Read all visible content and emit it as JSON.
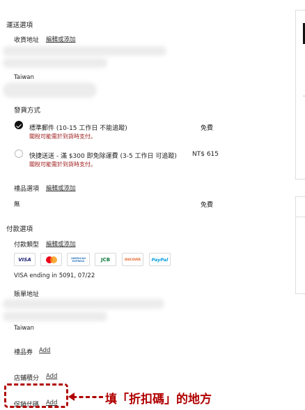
{
  "shipping": {
    "section_title": "運送選項",
    "address_label": "收貨地址",
    "address_edit": "編輯或添加",
    "address_country": "Taiwan",
    "method_title": "發貨方式",
    "options": [
      {
        "title": "標準郵件 (10-15 工作日 不能追蹤)",
        "note": "關稅可能需於到貨時支付。",
        "price": "免費",
        "selected": true
      },
      {
        "title": "快捷送送 - 滿 $300 即免除運費 (3-5 工作日 可追蹤)",
        "note": "關稅可能需於到貨時支付。",
        "price": "NT$ 615",
        "selected": false
      }
    ],
    "gift_label": "禮品選項",
    "gift_edit": "編輯或添加",
    "gift_value": "無",
    "gift_price": "免費"
  },
  "payment": {
    "section_title": "付款選項",
    "type_label": "付款類型",
    "type_edit": "編輯或添加",
    "cards": [
      {
        "icon": "visa-card-icon",
        "text": "VISA",
        "color": "#1a1f71"
      },
      {
        "icon": "mastercard-icon",
        "text": "",
        "color": "#eb001b"
      },
      {
        "icon": "amex-card-icon",
        "text": "AMERICAN EXPRESS",
        "color": "#2e77bb"
      },
      {
        "icon": "jcb-card-icon",
        "text": "JCB",
        "color": "#0b7a3e"
      },
      {
        "icon": "discover-card-icon",
        "text": "DISCOVER",
        "color": "#e55c20"
      },
      {
        "icon": "paypal-icon",
        "text": "PayPal",
        "color": "#009cde"
      }
    ],
    "card_info": "VISA ending in 5091, 07/22",
    "billing_label": "賬單地址",
    "billing_country": "Taiwan",
    "voucher_label": "禮品券",
    "voucher_add": "Add",
    "points_label": "店鋪積分",
    "points_add": "Add",
    "promo_label": "促銷代碼",
    "promo_add": "Add"
  },
  "annotation": {
    "text": "填「折扣碼」的地方",
    "color": "#b00000"
  }
}
